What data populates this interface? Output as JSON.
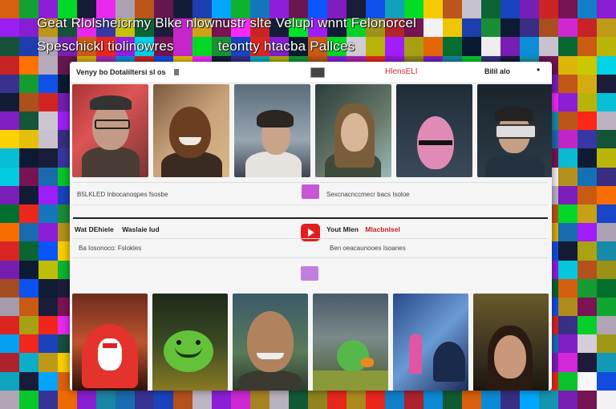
{
  "overlay": {
    "line1": "Geat Rlolsheicrmy Blke nlownustr slte Velupi wnnt Felonorcel",
    "line2a": "Speschickl tiolinowres",
    "line2b": "teontty htacba Pallces"
  },
  "toolbar": {
    "left_label": "Venyy bo Dotaliltersi sl os",
    "red_label": "HlensELI",
    "right_label": "Bilil alo",
    "more": "•"
  },
  "row1_meta": {
    "left": "B5LKLED Inbocanoqpes fsosbe",
    "right": "Sexcnacnccmecr bacs Isoloe"
  },
  "section2": {
    "title_left": "Wat DEhiele",
    "title_left_b": "Waslaie Iud",
    "meta_left": "Ba Iosonoco: Fslokles",
    "title_right_a": "Yout Mlen",
    "title_right_b": "Mlacbnlsel",
    "meta_right": "Ben oeacaunooes Isoanes"
  },
  "icons": {
    "toolbar_icon": "cursor-icon",
    "image_icon": "image-icon",
    "more_icon": "more-icon",
    "play_icon": "play-icon"
  },
  "colors": {
    "accent_red": "#e31d1d",
    "chip_purple": "#c757d6"
  }
}
